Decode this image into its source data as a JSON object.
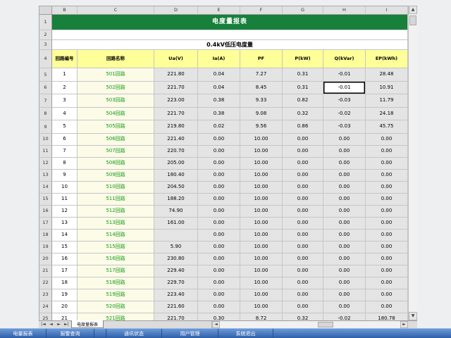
{
  "sheet": {
    "column_letters": [
      "B",
      "C",
      "D",
      "E",
      "F",
      "G",
      "H",
      "I"
    ],
    "row_numbers": [
      "1",
      "2",
      "3",
      "4",
      "5",
      "6",
      "7",
      "8",
      "9",
      "10",
      "11",
      "12",
      "13",
      "14",
      "15",
      "16",
      "17",
      "18",
      "19",
      "20",
      "21",
      "22",
      "23",
      "24",
      "25"
    ],
    "title": "电度量报表",
    "subtitle": "0.4kV低压电度量",
    "headers": [
      "回路编号",
      "回路名称",
      "Ua(V)",
      "Ia(A)",
      "PF",
      "P(kW)",
      "Q(kVar)",
      "EP(kWh)"
    ],
    "rows": [
      [
        "1",
        "501回路",
        "221.80",
        "0.04",
        "7.27",
        "0.31",
        "-0.01",
        "28.48"
      ],
      [
        "2",
        "502回路",
        "221.70",
        "0.04",
        "8.45",
        "0.31",
        "-0.01",
        "10.91"
      ],
      [
        "3",
        "503回路",
        "223.00",
        "0.38",
        "9.33",
        "0.82",
        "-0.03",
        "11.79"
      ],
      [
        "4",
        "504回路",
        "221.70",
        "0.38",
        "9.08",
        "0.32",
        "-0.02",
        "24.18"
      ],
      [
        "5",
        "505回路",
        "219.80",
        "0.02",
        "9.56",
        "0.86",
        "-0.03",
        "45.75"
      ],
      [
        "6",
        "506回路",
        "221.40",
        "0.00",
        "10.00",
        "0.00",
        "0.00",
        "0.00"
      ],
      [
        "7",
        "507回路",
        "220.70",
        "0.00",
        "10.00",
        "0.00",
        "0.00",
        "0.00"
      ],
      [
        "8",
        "508回路",
        "205.00",
        "0.00",
        "10.00",
        "0.00",
        "0.00",
        "0.00"
      ],
      [
        "9",
        "509回路",
        "180.40",
        "0.00",
        "10.00",
        "0.00",
        "0.00",
        "0.00"
      ],
      [
        "10",
        "510回路",
        "204.50",
        "0.00",
        "10.00",
        "0.00",
        "0.00",
        "0.00"
      ],
      [
        "11",
        "511回路",
        "188.20",
        "0.00",
        "10.00",
        "0.00",
        "0.00",
        "0.00"
      ],
      [
        "12",
        "512回路",
        "74.90",
        "0.00",
        "10.00",
        "0.00",
        "0.00",
        "0.00"
      ],
      [
        "13",
        "513回路",
        "161.00",
        "0.00",
        "10.00",
        "0.00",
        "0.00",
        "0.00"
      ],
      [
        "14",
        "514回路",
        "",
        "0.00",
        "10.00",
        "0.00",
        "0.00",
        "0.00"
      ],
      [
        "15",
        "515回路",
        "5.90",
        "0.00",
        "10.00",
        "0.00",
        "0.00",
        "0.00"
      ],
      [
        "16",
        "516回路",
        "230.80",
        "0.00",
        "10.00",
        "0.00",
        "0.00",
        "0.00"
      ],
      [
        "17",
        "517回路",
        "229.40",
        "0.00",
        "10.00",
        "0.00",
        "0.00",
        "0.00"
      ],
      [
        "18",
        "518回路",
        "229.70",
        "0.00",
        "10.00",
        "0.00",
        "0.00",
        "0.00"
      ],
      [
        "19",
        "519回路",
        "223.40",
        "0.00",
        "10.00",
        "0.00",
        "0.00",
        "0.00"
      ],
      [
        "20",
        "520回路",
        "221.60",
        "0.00",
        "10.00",
        "0.00",
        "0.00",
        "0.00"
      ],
      [
        "21",
        "521回路",
        "221.70",
        "0.30",
        "8.72",
        "0.32",
        "-0.02",
        "180.78"
      ]
    ]
  },
  "sheet_tabs": [
    {
      "label": "电度量报表"
    }
  ],
  "taskbar": {
    "buttons": [
      "电量报表",
      "报警查询",
      "通讯状态",
      "用户管理",
      "系统退出"
    ]
  },
  "icons": {
    "scroll_up": "up-arrow-icon",
    "scroll_down": "down-arrow-icon",
    "scroll_left": "left-arrow-icon",
    "scroll_right": "right-arrow-icon",
    "first_sheet": "first-sheet-icon",
    "prev_sheet": "prev-sheet-icon",
    "next_sheet": "next-sheet-icon",
    "last_sheet": "last-sheet-icon"
  },
  "colors": {
    "title_fill": "#17803b",
    "header_fill": "#ffff99",
    "circuit_name_text": "#129a12",
    "value_cell_fill": "#e4e4e4",
    "taskbar": "#2f5fa9"
  }
}
